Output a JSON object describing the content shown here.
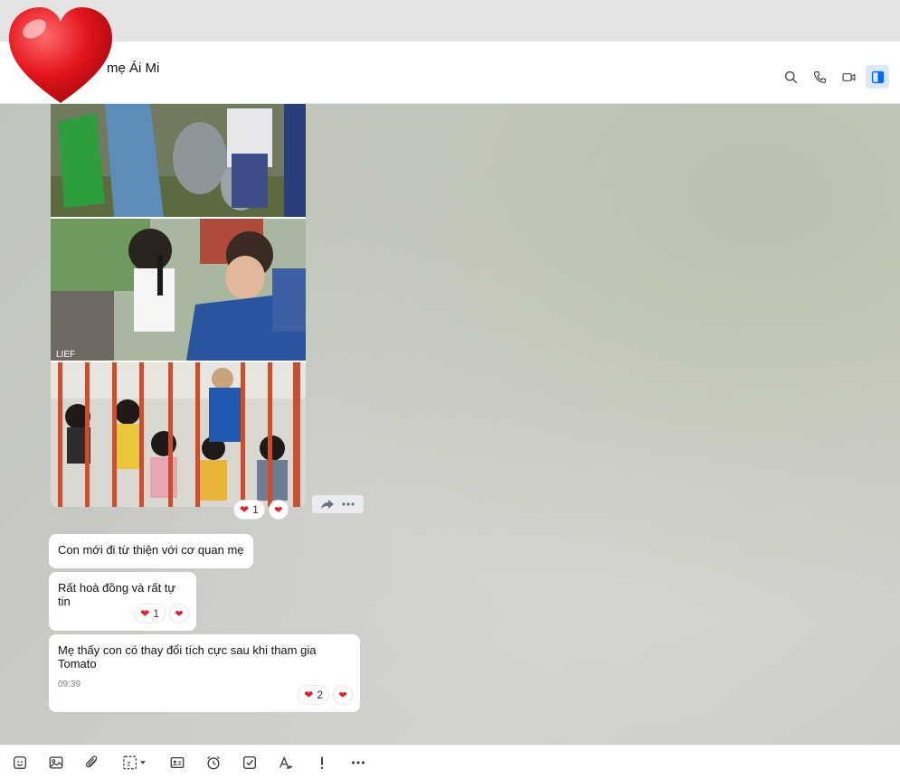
{
  "header": {
    "title": "mẹ Ái Mi",
    "icons": [
      "search-icon",
      "phone-icon",
      "video-call-icon",
      "sidebar-toggle-icon"
    ]
  },
  "sticker": {
    "icon": "heart-icon",
    "color": "#e3141c"
  },
  "photo_message": {
    "photos": [
      "photo-1",
      "photo-2",
      "photo-3"
    ],
    "reaction_count": "1",
    "photo_2_caption": "LIEF"
  },
  "messages": [
    {
      "text": "Con mới đi từ thiện với cơ quan mẹ"
    },
    {
      "text": "Rất hoà đồng và rất tự tin",
      "reaction_count": "1"
    },
    {
      "text": "Mẹ thấy con có thay đổi tích cực sau khi tham gia Tomato",
      "time": "09:39",
      "reaction_count": "2"
    }
  ],
  "toolbar": {
    "icons": [
      "sticker-icon",
      "image-icon",
      "attachment-icon",
      "screenshot-icon",
      "contact-card-icon",
      "reminder-icon",
      "task-icon",
      "format-icon",
      "important-icon",
      "more-icon"
    ]
  },
  "colors": {
    "accent": "#0068ff",
    "heart": "#e0222e",
    "header_bg": "#ffffff"
  }
}
